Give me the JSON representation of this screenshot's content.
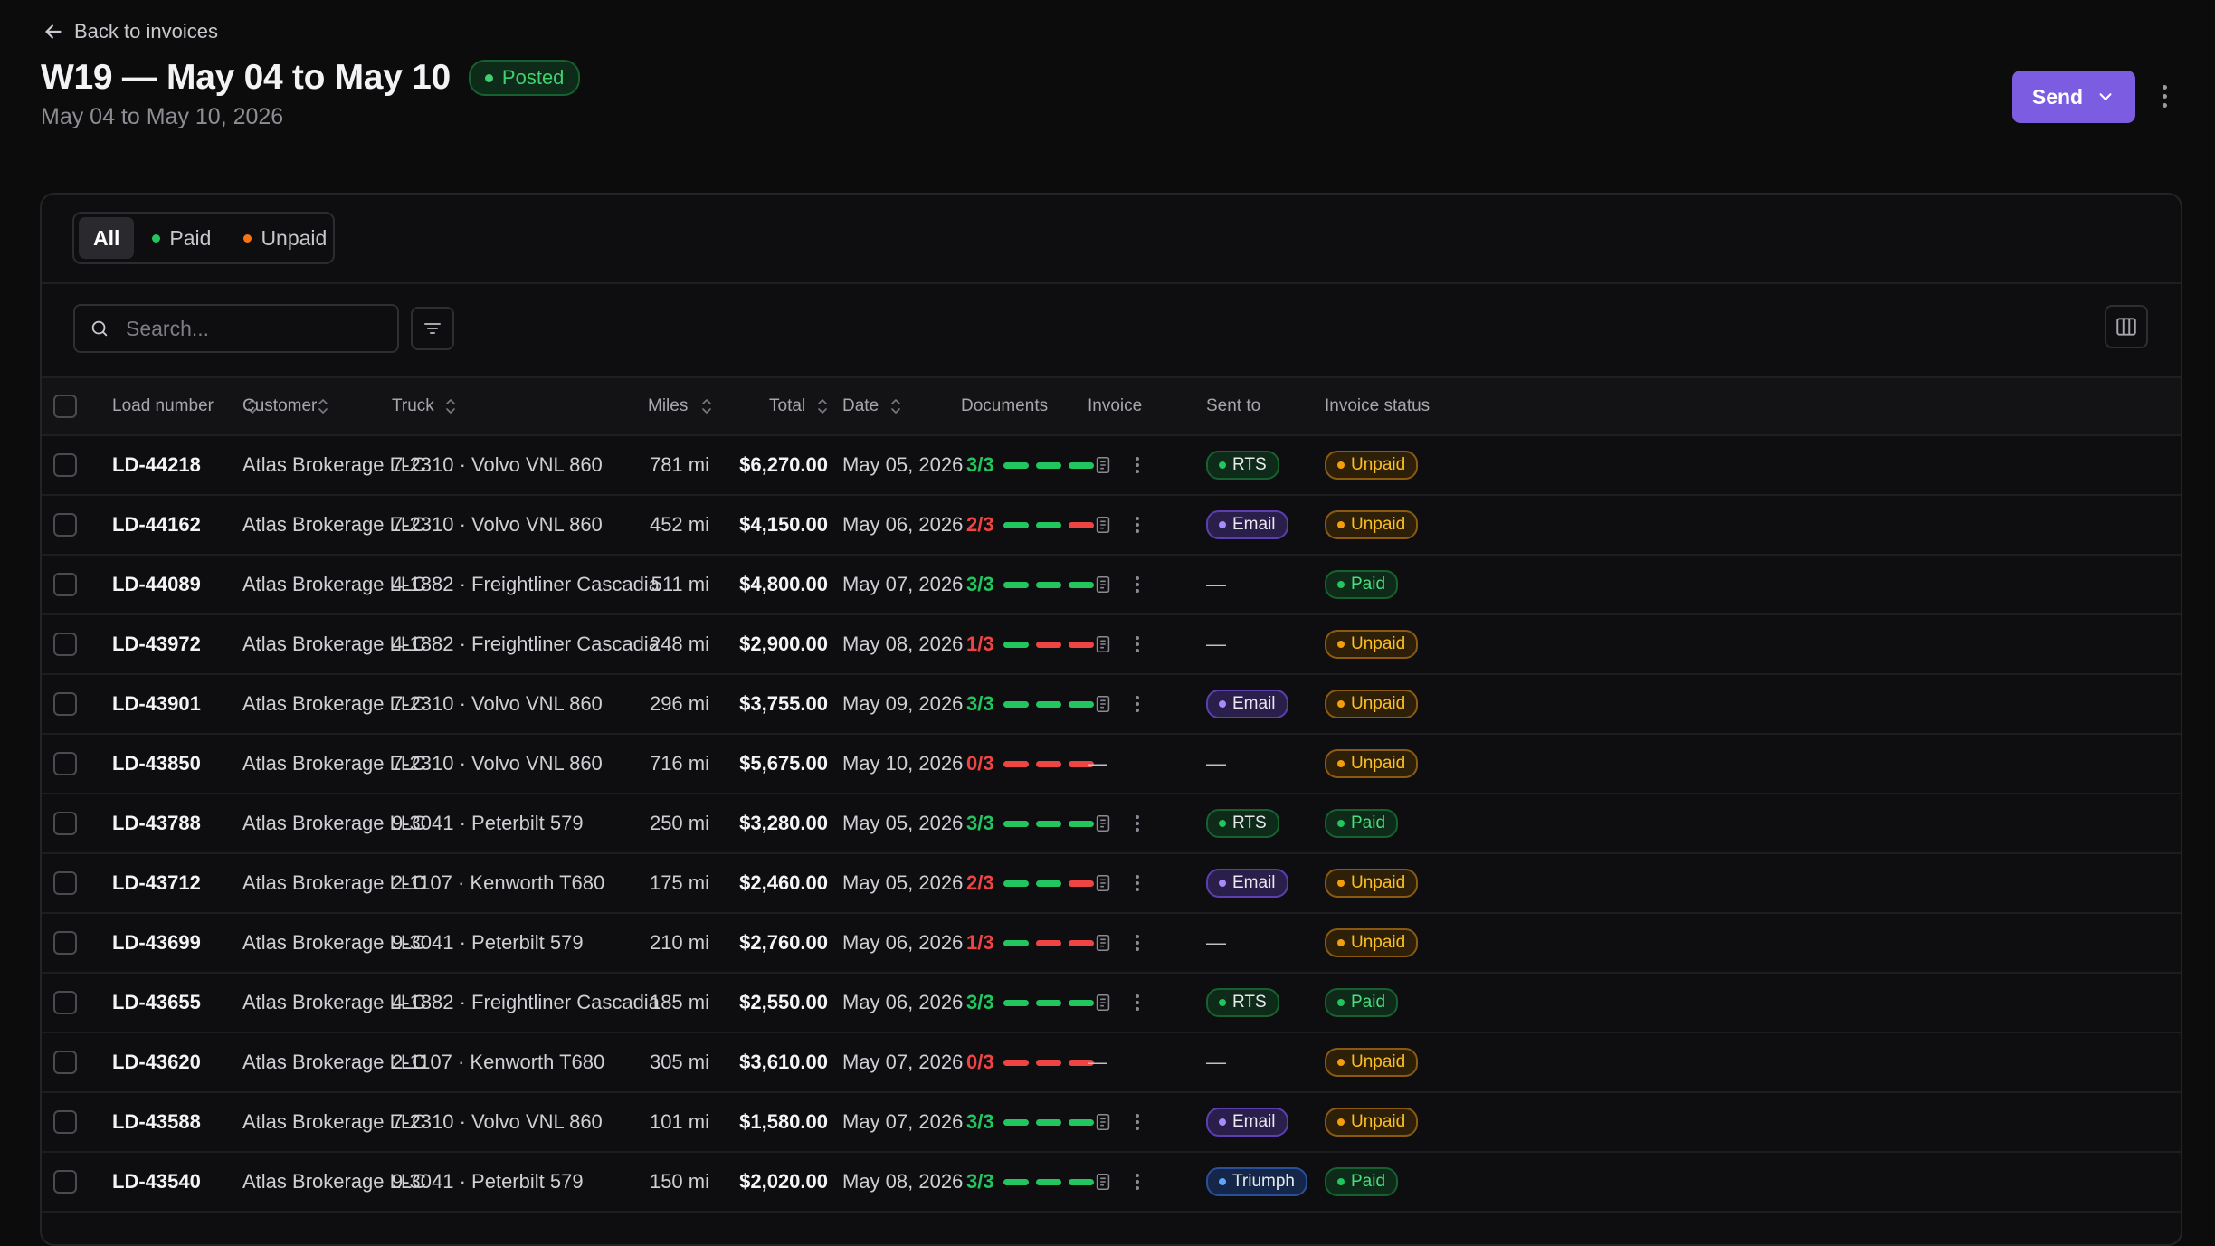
{
  "nav": {
    "back_label": "Back to invoices"
  },
  "header": {
    "title": "W19 — May 04 to May 10",
    "status": "Posted",
    "subtitle": "May 04 to May 10, 2026",
    "send_label": "Send"
  },
  "filters": {
    "tabs": [
      {
        "label": "All",
        "dot": null
      },
      {
        "label": "Paid",
        "dot": "#22c55e"
      },
      {
        "label": "Unpaid",
        "dot": "#f97316"
      }
    ],
    "search_placeholder": "Search..."
  },
  "table": {
    "columns": [
      "Load number",
      "Customer",
      "Truck",
      "Miles",
      "Total",
      "Date",
      "Documents",
      "Invoice",
      "Sent to",
      "Invoice status"
    ],
    "rows": [
      {
        "load": "LD-44218",
        "customer": "Atlas Brokerage LLC",
        "truck": "7-2310 · Volvo VNL 860",
        "miles": "781 mi",
        "total": "$6,270.00",
        "date": "May 05, 2026",
        "docs": "3/3",
        "docs_count": 3,
        "has_invoice": true,
        "sent_to": "RTS",
        "status": "Unpaid"
      },
      {
        "load": "LD-44162",
        "customer": "Atlas Brokerage LLC",
        "truck": "7-2310 · Volvo VNL 860",
        "miles": "452 mi",
        "total": "$4,150.00",
        "date": "May 06, 2026",
        "docs": "2/3",
        "docs_count": 2,
        "has_invoice": true,
        "sent_to": "Email",
        "status": "Unpaid"
      },
      {
        "load": "LD-44089",
        "customer": "Atlas Brokerage LLC",
        "truck": "4-1882 · Freightliner Cascadia",
        "miles": "511 mi",
        "total": "$4,800.00",
        "date": "May 07, 2026",
        "docs": "3/3",
        "docs_count": 3,
        "has_invoice": true,
        "sent_to": "—",
        "status": "Paid"
      },
      {
        "load": "LD-43972",
        "customer": "Atlas Brokerage LLC",
        "truck": "4-1882 · Freightliner Cascadia",
        "miles": "248 mi",
        "total": "$2,900.00",
        "date": "May 08, 2026",
        "docs": "1/3",
        "docs_count": 1,
        "has_invoice": true,
        "sent_to": "—",
        "status": "Unpaid"
      },
      {
        "load": "LD-43901",
        "customer": "Atlas Brokerage LLC",
        "truck": "7-2310 · Volvo VNL 860",
        "miles": "296 mi",
        "total": "$3,755.00",
        "date": "May 09, 2026",
        "docs": "3/3",
        "docs_count": 3,
        "has_invoice": true,
        "sent_to": "Email",
        "status": "Unpaid"
      },
      {
        "load": "LD-43850",
        "customer": "Atlas Brokerage LLC",
        "truck": "7-2310 · Volvo VNL 860",
        "miles": "716 mi",
        "total": "$5,675.00",
        "date": "May 10, 2026",
        "docs": "0/3",
        "docs_count": 0,
        "has_invoice": false,
        "sent_to": "—",
        "status": "Unpaid"
      },
      {
        "load": "LD-43788",
        "customer": "Atlas Brokerage LLC",
        "truck": "9-3041 · Peterbilt 579",
        "miles": "250 mi",
        "total": "$3,280.00",
        "date": "May 05, 2026",
        "docs": "3/3",
        "docs_count": 3,
        "has_invoice": true,
        "sent_to": "RTS",
        "status": "Paid"
      },
      {
        "load": "LD-43712",
        "customer": "Atlas Brokerage LLC",
        "truck": "2-1107 · Kenworth T680",
        "miles": "175 mi",
        "total": "$2,460.00",
        "date": "May 05, 2026",
        "docs": "2/3",
        "docs_count": 2,
        "has_invoice": true,
        "sent_to": "Email",
        "status": "Unpaid"
      },
      {
        "load": "LD-43699",
        "customer": "Atlas Brokerage LLC",
        "truck": "9-3041 · Peterbilt 579",
        "miles": "210 mi",
        "total": "$2,760.00",
        "date": "May 06, 2026",
        "docs": "1/3",
        "docs_count": 1,
        "has_invoice": true,
        "sent_to": "—",
        "status": "Unpaid"
      },
      {
        "load": "LD-43655",
        "customer": "Atlas Brokerage LLC",
        "truck": "4-1882 · Freightliner Cascadia",
        "miles": "185 mi",
        "total": "$2,550.00",
        "date": "May 06, 2026",
        "docs": "3/3",
        "docs_count": 3,
        "has_invoice": true,
        "sent_to": "RTS",
        "status": "Paid"
      },
      {
        "load": "LD-43620",
        "customer": "Atlas Brokerage LLC",
        "truck": "2-1107 · Kenworth T680",
        "miles": "305 mi",
        "total": "$3,610.00",
        "date": "May 07, 2026",
        "docs": "0/3",
        "docs_count": 0,
        "has_invoice": false,
        "sent_to": "—",
        "status": "Unpaid"
      },
      {
        "load": "LD-43588",
        "customer": "Atlas Brokerage LLC",
        "truck": "7-2310 · Volvo VNL 860",
        "miles": "101 mi",
        "total": "$1,580.00",
        "date": "May 07, 2026",
        "docs": "3/3",
        "docs_count": 3,
        "has_invoice": true,
        "sent_to": "Email",
        "status": "Unpaid"
      },
      {
        "load": "LD-43540",
        "customer": "Atlas Brokerage LLC",
        "truck": "9-3041 · Peterbilt 579",
        "miles": "150 mi",
        "total": "$2,020.00",
        "date": "May 08, 2026",
        "docs": "3/3",
        "docs_count": 3,
        "has_invoice": true,
        "sent_to": "Triumph",
        "status": "Paid"
      }
    ]
  },
  "colors": {
    "accent": "#7c5ce0",
    "green": "#22c55e",
    "red": "#ef4444",
    "rts": "#22c55e",
    "email": "#a78bfa",
    "triumph": "#60a5fa",
    "unpaid": "#f59e0b",
    "paid": "#22c55e"
  }
}
